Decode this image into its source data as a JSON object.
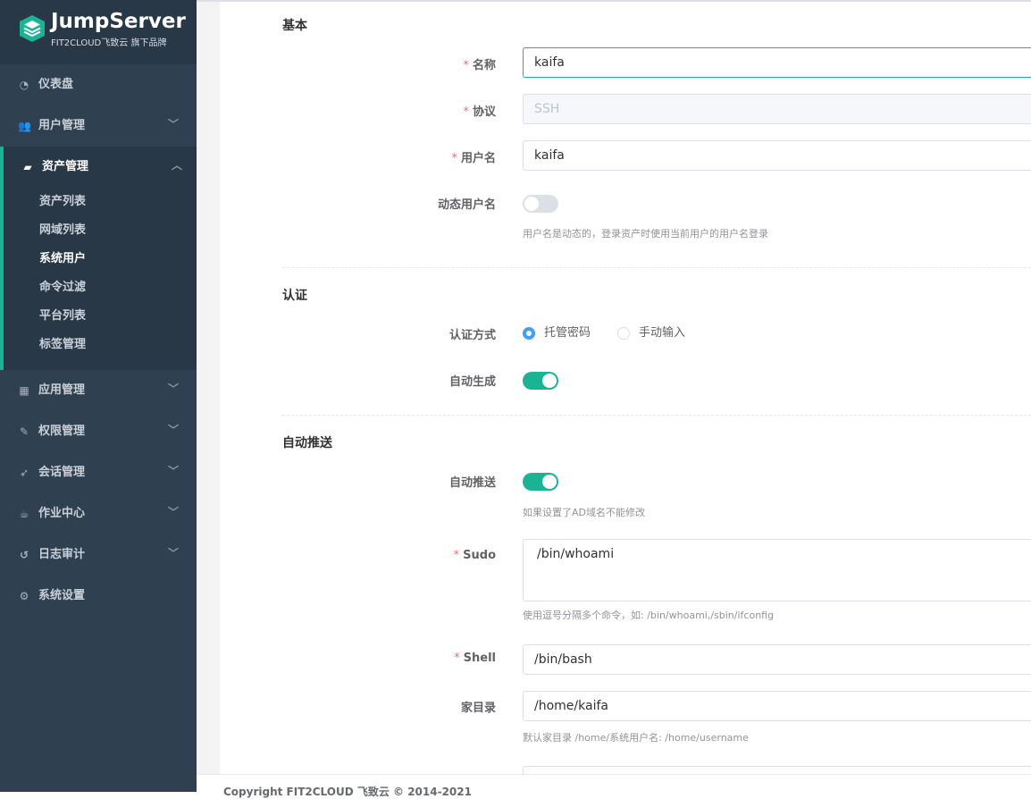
{
  "brand": {
    "title": "JumpServer",
    "subtitle": "FIT2CLOUD飞致云 旗下品牌"
  },
  "sidebar": {
    "items": [
      {
        "label": "仪表盘",
        "icon": "dashboard-icon"
      },
      {
        "label": "用户管理",
        "icon": "users-icon"
      },
      {
        "label": "资产管理",
        "icon": "inbox-icon",
        "expanded": true
      },
      {
        "label": "应用管理",
        "icon": "grid-icon"
      },
      {
        "label": "权限管理",
        "icon": "edit-icon"
      },
      {
        "label": "会话管理",
        "icon": "rocket-icon"
      },
      {
        "label": "作业中心",
        "icon": "coffee-icon"
      },
      {
        "label": "日志审计",
        "icon": "history-icon"
      },
      {
        "label": "系统设置",
        "icon": "gears-icon"
      }
    ],
    "sub_items": [
      {
        "label": "资产列表"
      },
      {
        "label": "网域列表"
      },
      {
        "label": "系统用户",
        "current": true
      },
      {
        "label": "命令过滤"
      },
      {
        "label": "平台列表"
      },
      {
        "label": "标签管理"
      }
    ]
  },
  "form": {
    "basic": {
      "title": "基本",
      "name_label": "名称",
      "name_value": "kaifa",
      "protocol_label": "协议",
      "protocol_value": "SSH",
      "username_label": "用户名",
      "username_value": "kaifa",
      "dynamic_label": "动态用户名",
      "dynamic_on": false,
      "dynamic_help": "用户名是动态的，登录资产时使用当前用户的用户名登录"
    },
    "auth": {
      "title": "认证",
      "method_label": "认证方式",
      "method_options": [
        "托管密码",
        "手动输入"
      ],
      "method_selected": "托管密码",
      "autogen_label": "自动生成",
      "autogen_on": true
    },
    "push": {
      "title": "自动推送",
      "push_label": "自动推送",
      "push_on": true,
      "push_help": "如果设置了AD域名不能修改",
      "sudo_label": "Sudo",
      "sudo_value": "/bin/whoami",
      "sudo_help": "使用逗号分隔多个命令，如: /bin/whoami,/sbin/ifconfig",
      "shell_label": "Shell",
      "shell_value": "/bin/bash",
      "home_label": "家目录",
      "home_value": "/home/kaifa",
      "home_help": "默认家目录 /home/系统用户名: /home/username"
    }
  },
  "footer": {
    "text": "Copyright FIT2CLOUD 飞致云 © 2014-2021"
  },
  "colors": {
    "sidebar_bg": "#2f4050",
    "accent": "#1ab394",
    "radio": "#409eff",
    "required": "#f56c6c"
  }
}
